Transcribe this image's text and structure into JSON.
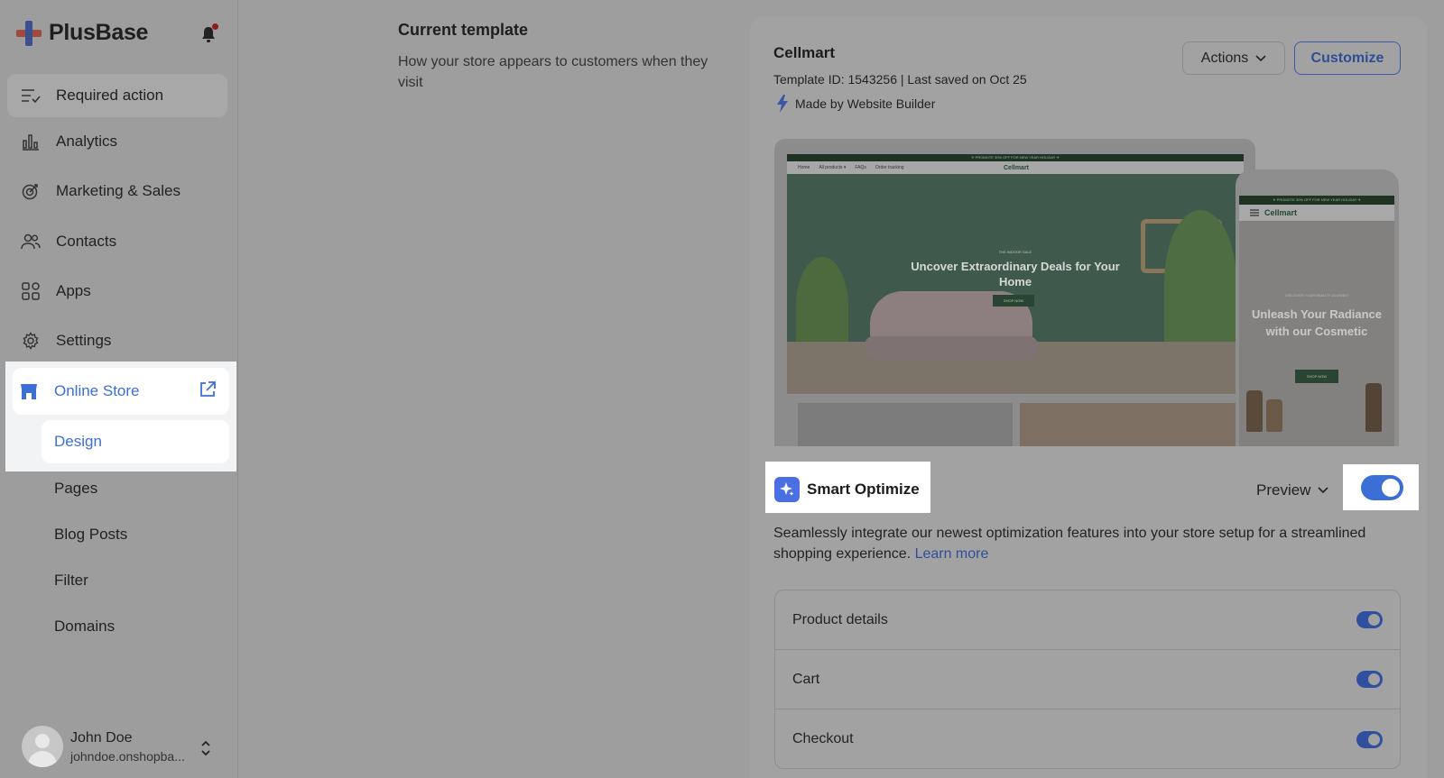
{
  "sidebar": {
    "brand": "PlusBase",
    "items": [
      {
        "label": "Required action",
        "icon": "list-check-icon"
      },
      {
        "label": "Analytics",
        "icon": "bar-chart-icon"
      },
      {
        "label": "Marketing & Sales",
        "icon": "target-icon"
      },
      {
        "label": "Contacts",
        "icon": "users-icon"
      },
      {
        "label": "Apps",
        "icon": "grid-icon"
      },
      {
        "label": "Settings",
        "icon": "gear-icon"
      }
    ],
    "online_store": {
      "label": "Online Store",
      "icon": "store-icon"
    },
    "sub_items": [
      "Design",
      "Pages",
      "Blog Posts",
      "Filter",
      "Domains"
    ],
    "user": {
      "name": "John Doe",
      "shop": "johndoe.onshopba..."
    }
  },
  "main": {
    "section_title": "Current template",
    "section_desc": "How your store appears to customers when they visit"
  },
  "template": {
    "name": "Cellmart",
    "meta": "Template ID: 1543256 | Last saved on Oct 25",
    "made_by": "Made by Website Builder",
    "actions_label": "Actions",
    "customize_label": "Customize"
  },
  "preview": {
    "desktop_promo": "✈ PROMOTE 30% OFF FOR NEW YEAR HOLIDAY ✈",
    "desktop_nav": [
      "Home",
      "All products ▾",
      "FAQs",
      "Order tracking"
    ],
    "desktop_brand": "Cellmart",
    "desktop_small": "THE INDOOR SALE",
    "desktop_heading": "Uncover Extraordinary Deals for Your Home",
    "desktop_cta": "SHOP NOW",
    "mobile_promo": "✈ PROMOTE 30% OFF FOR NEW YEAR HOLIDAY ✈",
    "mobile_brand": "Cellmart",
    "mobile_small": "DISCOVER YOUR BEAUTY JOURNEY",
    "mobile_heading": "Unleash Your Radiance with our Cosmetic",
    "mobile_cta": "SHOP NOW"
  },
  "smart_optimize": {
    "label": "Smart Optimize",
    "preview_label": "Preview",
    "enabled": true,
    "description": "Seamlessly integrate our newest optimization features into your store setup for a streamlined shopping experience.",
    "learn_more": "Learn more",
    "options": [
      {
        "label": "Product details",
        "enabled": true
      },
      {
        "label": "Cart",
        "enabled": true
      },
      {
        "label": "Checkout",
        "enabled": true
      }
    ]
  },
  "colors": {
    "accent": "#3c6fd6",
    "overlay_gray": "#9e9e9e",
    "notification": "#8a1e1e"
  }
}
